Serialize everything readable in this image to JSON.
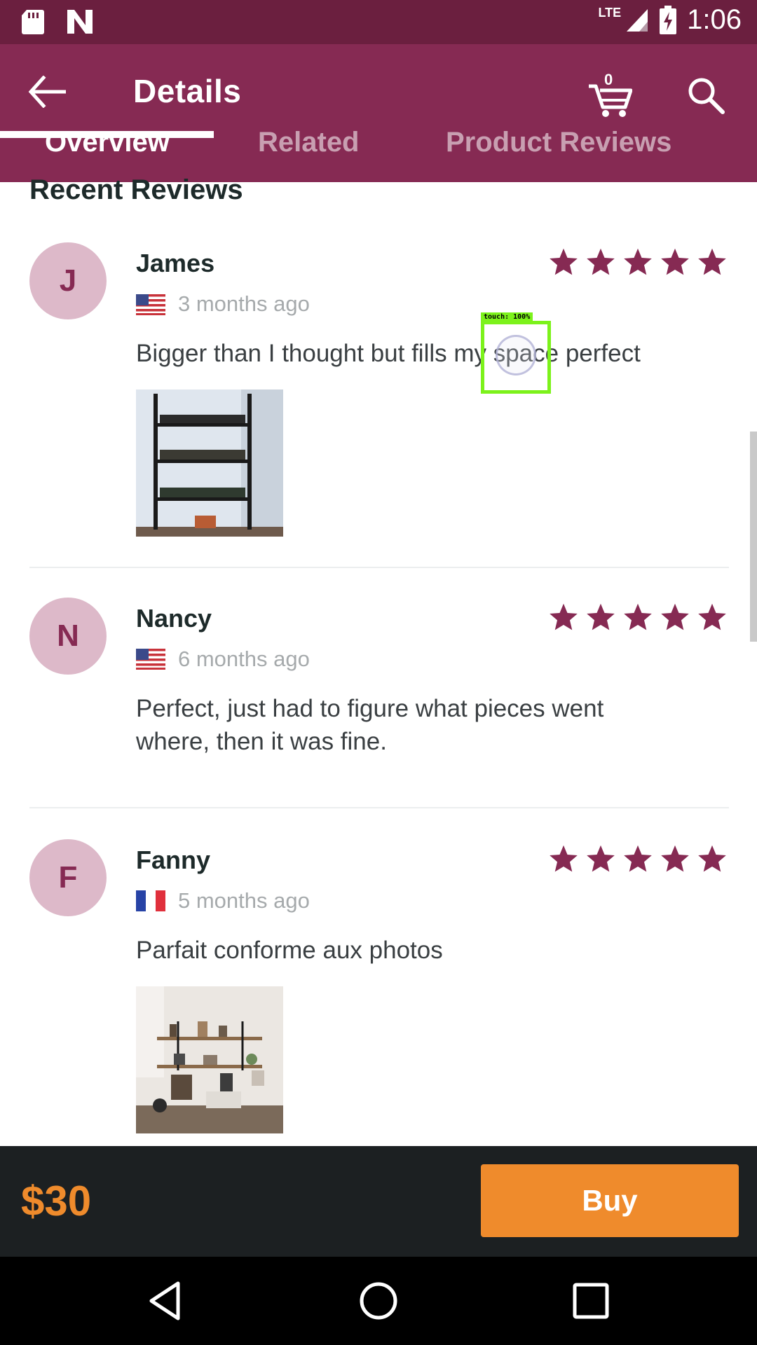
{
  "status_bar": {
    "time": "1:06",
    "network": "LTE",
    "icons": [
      "sd-card-icon",
      "n-notification-icon",
      "signal-icon",
      "battery-charging-icon"
    ]
  },
  "app_bar": {
    "title": "Details",
    "cart_count": "0",
    "tabs": [
      {
        "label": "Overview",
        "active": true
      },
      {
        "label": "Related",
        "active": false
      },
      {
        "label": "Product Reviews",
        "active": false
      }
    ],
    "color": "#862a53"
  },
  "section_title": "Recent Reviews",
  "reviews": [
    {
      "initial": "J",
      "name": "James",
      "country_flag": "us-flag-icon",
      "time": "3 months ago",
      "rating": 5,
      "comment": "Bigger than I thought but fills my space perfect",
      "has_photo": true
    },
    {
      "initial": "N",
      "name": "Nancy",
      "country_flag": "us-flag-icon",
      "time": "6 months ago",
      "rating": 5,
      "comment": "Perfect, just had to figure what pieces went where, then it was fine.",
      "has_photo": false
    },
    {
      "initial": "F",
      "name": "Fanny",
      "country_flag": "fr-flag-icon",
      "time": "5 months ago",
      "rating": 5,
      "comment": "Parfait conforme aux photos",
      "has_photo": true
    }
  ],
  "touch_overlay": {
    "label": "touch: 100%"
  },
  "bottom_bar": {
    "price": "$30",
    "buy_label": "Buy",
    "accent": "#ef8b2c"
  }
}
